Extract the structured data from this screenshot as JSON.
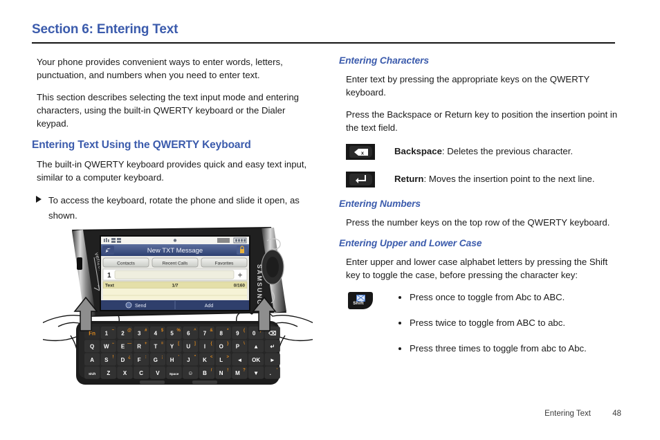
{
  "header": {
    "section_title": "Section 6: Entering Text"
  },
  "left_column": {
    "intro_1": "Your phone provides convenient ways to enter words, letters, punctuation, and numbers when you need to enter text.",
    "intro_2": "This section describes selecting the text input mode and entering characters, using the built-in QWERTY keyboard or the Dialer keypad.",
    "heading": "Entering Text Using the QWERTY Keyboard",
    "para_1": "The built-in QWERTY keyboard provides quick and easy text input, similar to a computer keyboard.",
    "step_1": "To access the keyboard, rotate the phone and slide it open, as shown."
  },
  "right_column": {
    "heading_characters": "Entering Characters",
    "char_para_1": "Enter text by pressing the appropriate keys on the QWERTY keyboard.",
    "char_para_2": "Press the Backspace or Return key to position the insertion point in the text field.",
    "keys": [
      {
        "icon": "backspace-key-icon",
        "name": "Backspace",
        "desc": ": Deletes the previous character."
      },
      {
        "icon": "return-key-icon",
        "name": "Return",
        "desc": ": Moves the insertion point to the next line."
      }
    ],
    "heading_numbers": "Entering Numbers",
    "numbers_para": "Press the number keys on the top row of the QWERTY keyboard.",
    "heading_case": "Entering Upper and Lower Case",
    "case_para": "Enter upper and lower case alphabet letters by pressing the Shift key to toggle the case, before pressing the character key:",
    "shift_key_label": "Shift",
    "case_bullets": [
      "Press once to toggle from Abc to ABC.",
      "Press twice to toggle from ABC to abc.",
      "Press three times to toggle from abc to Abc."
    ]
  },
  "figure": {
    "brand_side": "SAMSUNG",
    "carrier_side": "verizon",
    "screen": {
      "title": "New TXT Message",
      "tabs": [
        "Contacts",
        "Recent Calls",
        "Favorites"
      ],
      "recipient_number": "1",
      "add_recipient": "+",
      "text_label": "Text",
      "page_count": "1/7",
      "char_count": "0/160",
      "softkey_left": "Send",
      "softkey_right": "Add"
    },
    "keyboard_rows": [
      [
        {
          "main": "Fn",
          "alt": "",
          "accent": true
        },
        {
          "main": "1",
          "alt": "~"
        },
        {
          "main": "2",
          "alt": "@"
        },
        {
          "main": "3",
          "alt": "#"
        },
        {
          "main": "4",
          "alt": "$"
        },
        {
          "main": "5",
          "alt": "%"
        },
        {
          "main": "6",
          "alt": "^"
        },
        {
          "main": "7",
          "alt": "&"
        },
        {
          "main": "8",
          "alt": "*"
        },
        {
          "main": "9",
          "alt": "("
        },
        {
          "main": "0",
          "alt": ")"
        },
        {
          "main": "⌫",
          "alt": ""
        }
      ],
      [
        {
          "main": "Q",
          "alt": ""
        },
        {
          "main": "W",
          "alt": "−"
        },
        {
          "main": "E",
          "alt": "—"
        },
        {
          "main": "R",
          "alt": "+"
        },
        {
          "main": "T",
          "alt": "="
        },
        {
          "main": "Y",
          "alt": "["
        },
        {
          "main": "U",
          "alt": "]"
        },
        {
          "main": "I",
          "alt": "{"
        },
        {
          "main": "O",
          "alt": "}"
        },
        {
          "main": "P",
          "alt": "\\"
        },
        {
          "main": "▲",
          "alt": ""
        },
        {
          "main": "↵",
          "alt": ""
        }
      ],
      [
        {
          "main": "A",
          "alt": ""
        },
        {
          "main": "S",
          "alt": "!"
        },
        {
          "main": "D",
          "alt": "¿"
        },
        {
          "main": "F",
          "alt": ":"
        },
        {
          "main": "G",
          "alt": ";"
        },
        {
          "main": "H",
          "alt": "'"
        },
        {
          "main": "J",
          "alt": "\""
        },
        {
          "main": "K",
          "alt": "<"
        },
        {
          "main": "L",
          "alt": ">"
        },
        {
          "main": "◄",
          "alt": ""
        },
        {
          "main": "OK",
          "alt": ""
        },
        {
          "main": "►",
          "alt": ""
        }
      ],
      [
        {
          "main": "Shift",
          "alt": ""
        },
        {
          "main": "Z",
          "alt": ""
        },
        {
          "main": "X",
          "alt": ""
        },
        {
          "main": "C",
          "alt": ""
        },
        {
          "main": "V",
          "alt": ""
        },
        {
          "main": "Space",
          "alt": ""
        },
        {
          "main": "☺",
          "alt": ""
        },
        {
          "main": "B",
          "alt": "/"
        },
        {
          "main": "N",
          "alt": "!"
        },
        {
          "main": "M",
          "alt": "?"
        },
        {
          "main": "▼",
          "alt": ""
        },
        {
          "main": ".",
          "alt": "'"
        }
      ]
    ]
  },
  "footer": {
    "chapter": "Entering Text",
    "page_number": "48"
  },
  "colors": {
    "heading_blue": "#3b5bac",
    "body_text": "#1a1a1a",
    "rule": "#141414",
    "key_accent_orange": "#e08a1e"
  }
}
